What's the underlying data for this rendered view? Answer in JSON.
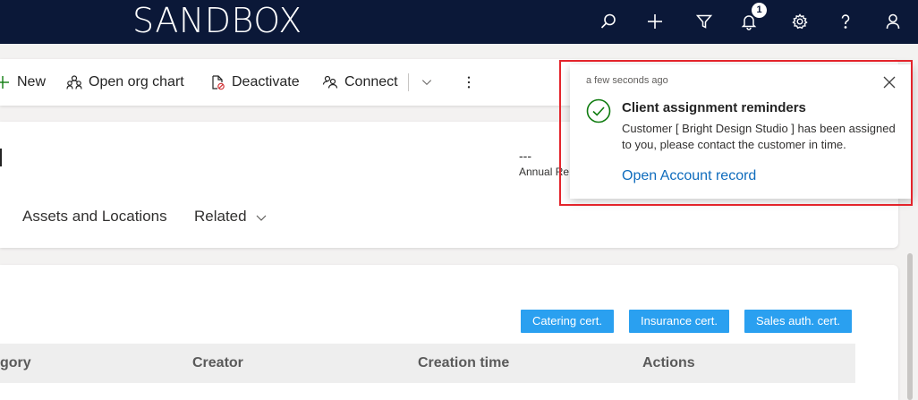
{
  "header": {
    "environment": "SANDBOX",
    "notification_count": "1"
  },
  "commands": {
    "new": "New",
    "org_chart": "Open org chart",
    "deactivate": "Deactivate",
    "connect": "Connect"
  },
  "record": {
    "annual_revenue_value": "---",
    "annual_revenue_label": "Annual Re",
    "tabs": [
      "Assets and Locations",
      "Related"
    ]
  },
  "certificates": {
    "buttons": [
      "Catering cert.",
      "Insurance cert.",
      "Sales auth. cert."
    ]
  },
  "grid": {
    "columns": [
      "gory",
      "Creator",
      "Creation time",
      "Actions"
    ]
  },
  "toast": {
    "time": "a few seconds ago",
    "title": "Client assignment reminders",
    "body": "Customer [ Bright Design Studio ] has been assigned to you, please contact the customer in time.",
    "link": "Open Account record"
  },
  "colors": {
    "header_bg": "#0b1838",
    "accent": "#2aa0f0",
    "link": "#0f6cbd",
    "success": "#107c10",
    "highlight_frame": "#e3242b"
  }
}
